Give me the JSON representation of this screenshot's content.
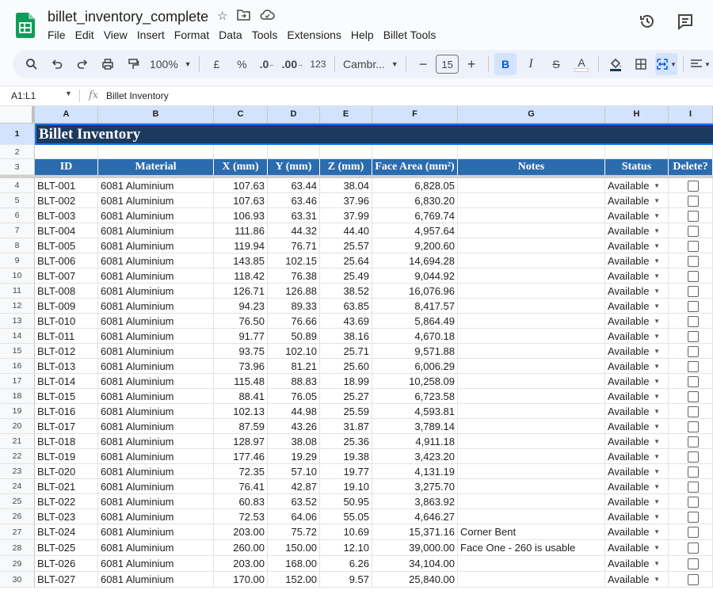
{
  "doc": {
    "title": "billet_inventory_complete",
    "menus": [
      "File",
      "Edit",
      "View",
      "Insert",
      "Format",
      "Data",
      "Tools",
      "Extensions",
      "Help",
      "Billet Tools"
    ]
  },
  "toolbar": {
    "zoom": "100%",
    "currency": "£",
    "percent": "%",
    "dec_decrease": ".0",
    "dec_increase": ".00",
    "format_123": "123",
    "font": "Cambr...",
    "font_size": "15",
    "bold": "B",
    "italic": "I",
    "strike": "S",
    "text_color": "A"
  },
  "formula_bar": {
    "name_box": "A1:L1",
    "fx": "fx",
    "content": "Billet Inventory"
  },
  "columns": [
    "A",
    "B",
    "C",
    "D",
    "E",
    "F",
    "G",
    "H",
    "I"
  ],
  "sheet": {
    "title": "Billet Inventory",
    "headers": [
      "ID",
      "Material",
      "X (mm)",
      "Y (mm)",
      "Z (mm)",
      "Face Area (mm²)",
      "Notes",
      "Status",
      "Delete?"
    ],
    "rows": [
      [
        "BLT-001",
        "6081 Aluminium",
        "107.63",
        "63.44",
        "38.04",
        "6,828.05",
        "",
        "Available"
      ],
      [
        "BLT-002",
        "6081 Aluminium",
        "107.63",
        "63.46",
        "37.96",
        "6,830.20",
        "",
        "Available"
      ],
      [
        "BLT-003",
        "6081 Aluminium",
        "106.93",
        "63.31",
        "37.99",
        "6,769.74",
        "",
        "Available"
      ],
      [
        "BLT-004",
        "6081 Aluminium",
        "111.86",
        "44.32",
        "44.40",
        "4,957.64",
        "",
        "Available"
      ],
      [
        "BLT-005",
        "6081 Aluminium",
        "119.94",
        "76.71",
        "25.57",
        "9,200.60",
        "",
        "Available"
      ],
      [
        "BLT-006",
        "6081 Aluminium",
        "143.85",
        "102.15",
        "25.64",
        "14,694.28",
        "",
        "Available"
      ],
      [
        "BLT-007",
        "6081 Aluminium",
        "118.42",
        "76.38",
        "25.49",
        "9,044.92",
        "",
        "Available"
      ],
      [
        "BLT-008",
        "6081 Aluminium",
        "126.71",
        "126.88",
        "38.52",
        "16,076.96",
        "",
        "Available"
      ],
      [
        "BLT-009",
        "6081 Aluminium",
        "94.23",
        "89.33",
        "63.85",
        "8,417.57",
        "",
        "Available"
      ],
      [
        "BLT-010",
        "6081 Aluminium",
        "76.50",
        "76.66",
        "43.69",
        "5,864.49",
        "",
        "Available"
      ],
      [
        "BLT-011",
        "6081 Aluminium",
        "91.77",
        "50.89",
        "38.16",
        "4,670.18",
        "",
        "Available"
      ],
      [
        "BLT-012",
        "6081 Aluminium",
        "93.75",
        "102.10",
        "25.71",
        "9,571.88",
        "",
        "Available"
      ],
      [
        "BLT-013",
        "6081 Aluminium",
        "73.96",
        "81.21",
        "25.60",
        "6,006.29",
        "",
        "Available"
      ],
      [
        "BLT-014",
        "6081 Aluminium",
        "115.48",
        "88.83",
        "18.99",
        "10,258.09",
        "",
        "Available"
      ],
      [
        "BLT-015",
        "6081 Aluminium",
        "88.41",
        "76.05",
        "25.27",
        "6,723.58",
        "",
        "Available"
      ],
      [
        "BLT-016",
        "6081 Aluminium",
        "102.13",
        "44.98",
        "25.59",
        "4,593.81",
        "",
        "Available"
      ],
      [
        "BLT-017",
        "6081 Aluminium",
        "87.59",
        "43.26",
        "31.87",
        "3,789.14",
        "",
        "Available"
      ],
      [
        "BLT-018",
        "6081 Aluminium",
        "128.97",
        "38.08",
        "25.36",
        "4,911.18",
        "",
        "Available"
      ],
      [
        "BLT-019",
        "6081 Aluminium",
        "177.46",
        "19.29",
        "19.38",
        "3,423.20",
        "",
        "Available"
      ],
      [
        "BLT-020",
        "6081 Aluminium",
        "72.35",
        "57.10",
        "19.77",
        "4,131.19",
        "",
        "Available"
      ],
      [
        "BLT-021",
        "6081 Aluminium",
        "76.41",
        "42.87",
        "19.10",
        "3,275.70",
        "",
        "Available"
      ],
      [
        "BLT-022",
        "6081 Aluminium",
        "60.83",
        "63.52",
        "50.95",
        "3,863.92",
        "",
        "Available"
      ],
      [
        "BLT-023",
        "6081 Aluminium",
        "72.53",
        "64.06",
        "55.05",
        "4,646.27",
        "",
        "Available"
      ],
      [
        "BLT-024",
        "6081 Aluminium",
        "203.00",
        "75.72",
        "10.69",
        "15,371.16",
        "Corner Bent",
        "Available"
      ],
      [
        "BLT-025",
        "6081 Aluminium",
        "260.00",
        "150.00",
        "12.10",
        "39,000.00",
        "Face One - 260 is usable",
        "Available"
      ],
      [
        "BLT-026",
        "6081 Aluminium",
        "203.00",
        "168.00",
        "6.26",
        "34,104.00",
        "",
        "Available"
      ],
      [
        "BLT-027",
        "6081 Aluminium",
        "170.00",
        "152.00",
        "9.57",
        "25,840.00",
        "",
        "Available"
      ]
    ]
  },
  "colors": {
    "title_bg": "#1c3a5e",
    "header_bg": "#2b6cb0",
    "selection": "#1a73e8",
    "sheets_green": "#0f9d58"
  }
}
